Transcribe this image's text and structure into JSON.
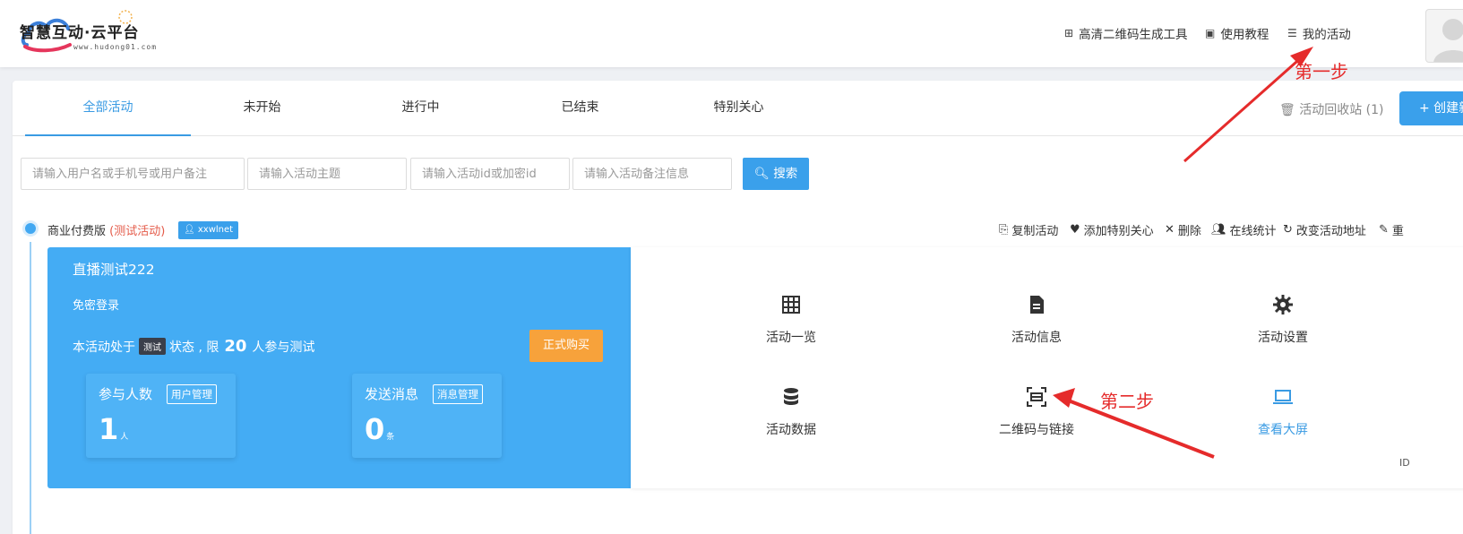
{
  "header": {
    "logo_text": "智慧互动·云平台",
    "logo_sub": "www.hudong01.com",
    "nav": [
      {
        "label": "高清二维码生成工具",
        "icon": "qr-grid-icon"
      },
      {
        "label": "使用教程",
        "icon": "book-icon"
      },
      {
        "label": "我的活动",
        "icon": "list-icon"
      }
    ]
  },
  "annotations": {
    "step1": "第一步",
    "step2": "第二步"
  },
  "tabs": [
    {
      "label": "全部活动",
      "active": true
    },
    {
      "label": "未开始",
      "active": false
    },
    {
      "label": "进行中",
      "active": false
    },
    {
      "label": "已结束",
      "active": false
    },
    {
      "label": "特别关心",
      "active": false
    }
  ],
  "toolbar": {
    "recycle_label": "活动回收站 (1)",
    "create_label": "+ 创建新"
  },
  "search": {
    "user_placeholder": "请输入用户名或手机号或用户备注",
    "topic_placeholder": "请输入活动主题",
    "id_placeholder": "请输入活动id或加密id",
    "note_placeholder": "请输入活动备注信息",
    "button_label": "搜索"
  },
  "activity": {
    "type_label": "商业付费版",
    "type_note": "(测试活动)",
    "user": "xxwlnet",
    "ops": [
      {
        "label": "复制活动",
        "icon": "copy-icon"
      },
      {
        "label": "添加特别关心",
        "icon": "heart-icon"
      },
      {
        "label": "删除",
        "icon": "close-icon"
      },
      {
        "label": "在线统计",
        "icon": "users-icon"
      },
      {
        "label": "改变活动地址",
        "icon": "refresh-icon"
      },
      {
        "label": "重",
        "icon": "edit-icon"
      }
    ],
    "title": "直播测试222",
    "login_mode": "免密登录",
    "status_prefix": "本活动处于",
    "status_tag": "测试",
    "status_mid": "状态 , 限",
    "status_limit": "20",
    "status_suffix": "人参与测试",
    "buy_label": "正式购买",
    "stats": [
      {
        "label": "参与人数",
        "button": "用户管理",
        "value": "1",
        "unit": "人"
      },
      {
        "label": "发送消息",
        "button": "消息管理",
        "value": "0",
        "unit": "条"
      }
    ],
    "grid": [
      {
        "label": "活动一览",
        "icon": "table-icon"
      },
      {
        "label": "活动信息",
        "icon": "document-icon"
      },
      {
        "label": "活动设置",
        "icon": "gear-icon"
      },
      {
        "label": "活动数据",
        "icon": "database-icon"
      },
      {
        "label": "二维码与链接",
        "icon": "qr-scan-icon"
      },
      {
        "label": "查看大屏",
        "icon": "laptop-icon"
      }
    ],
    "id_fragment": "ID"
  },
  "colors": {
    "accent": "#3aa0eb",
    "panel_blue": "#44acf4",
    "buy_orange": "#f7a23b",
    "annotation_red": "#e52b2b"
  }
}
